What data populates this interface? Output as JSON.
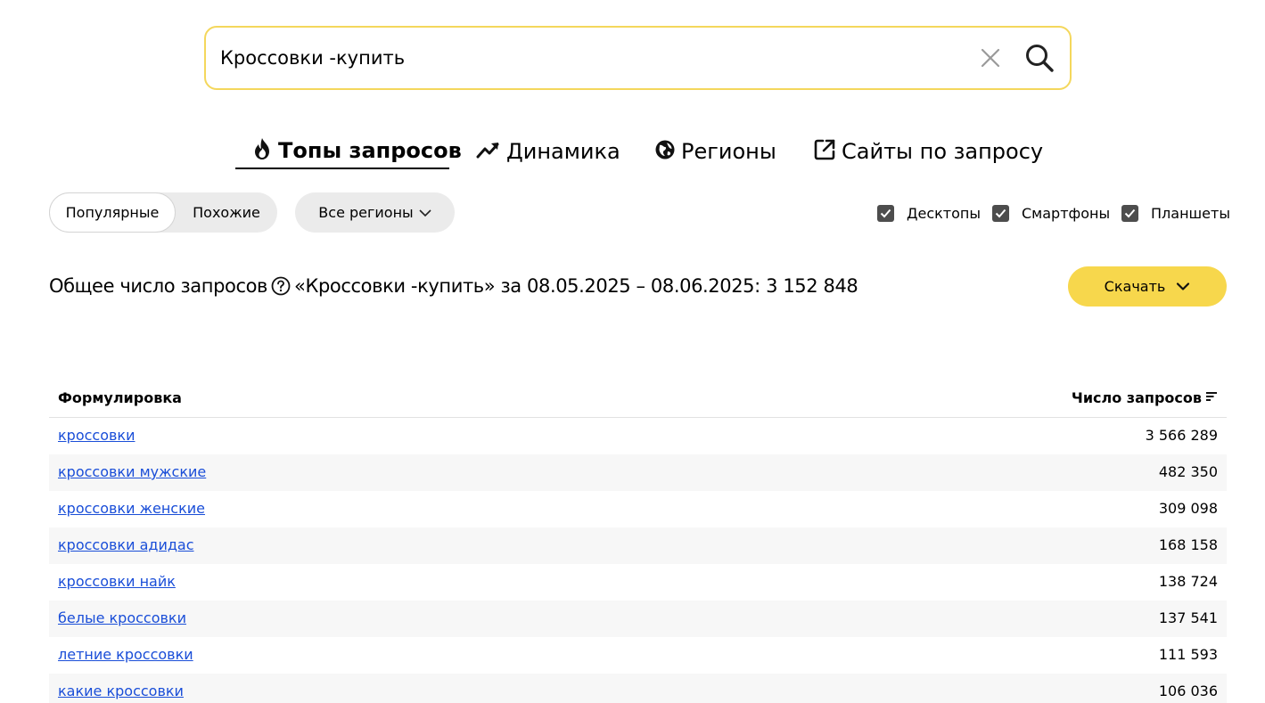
{
  "search": {
    "value": "Кроссовки -купить"
  },
  "tabs": [
    {
      "label": "Топы запросов",
      "icon": "fire-icon",
      "active": true
    },
    {
      "label": "Динамика",
      "icon": "trend-up-icon",
      "active": false
    },
    {
      "label": "Регионы",
      "icon": "globe-icon",
      "active": false
    },
    {
      "label": "Сайты по запросу",
      "icon": "external-link-icon",
      "active": false
    }
  ],
  "filters": {
    "popular_label": "Популярные",
    "similar_label": "Похожие",
    "regions_label": "Все регионы",
    "devices": [
      {
        "label": "Десктопы",
        "checked": true
      },
      {
        "label": "Смартфоны",
        "checked": true
      },
      {
        "label": "Планшеты",
        "checked": true
      }
    ]
  },
  "total": {
    "prefix": "Общее число запросов",
    "text": "«Кроссовки -купить» за 08.05.2025 – 08.06.2025: 3 152 848"
  },
  "download_label": "Скачать",
  "table": {
    "col_phrase": "Формулировка",
    "col_count": "Число запросов",
    "rows": [
      {
        "phrase": "кроссовки",
        "count": "3 566 289"
      },
      {
        "phrase": "кроссовки мужские",
        "count": "482 350"
      },
      {
        "phrase": "кроссовки женские",
        "count": "309 098"
      },
      {
        "phrase": "кроссовки адидас",
        "count": "168 158"
      },
      {
        "phrase": "кроссовки найк",
        "count": "138 724"
      },
      {
        "phrase": "белые кроссовки",
        "count": "137 541"
      },
      {
        "phrase": "летние кроссовки",
        "count": "111 593"
      },
      {
        "phrase": "какие кроссовки",
        "count": "106 036"
      }
    ]
  },
  "colors": {
    "accent_yellow": "#f7d74c",
    "search_border": "#f4d75c",
    "link_blue": "#1a4ed8",
    "checkbox": "#4d4d4d"
  }
}
